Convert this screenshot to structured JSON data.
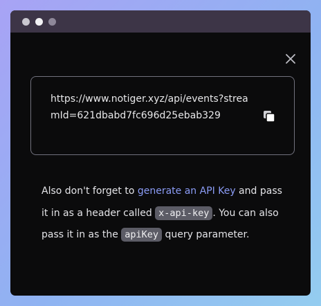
{
  "url_box": {
    "url": "https://www.notiger.xyz/api/events?streamId=621dbabd7fc696d25ebab329"
  },
  "help": {
    "text1": "Also don't forget to ",
    "link": "generate an API Key",
    "text2": " and pass it in as a header called ",
    "code1": "x-api-key",
    "text3": ". You can also pass it in as the ",
    "code2": "apiKey",
    "text4": " query parameter."
  },
  "icons": {
    "close": "close-icon",
    "copy": "copy-icon"
  }
}
